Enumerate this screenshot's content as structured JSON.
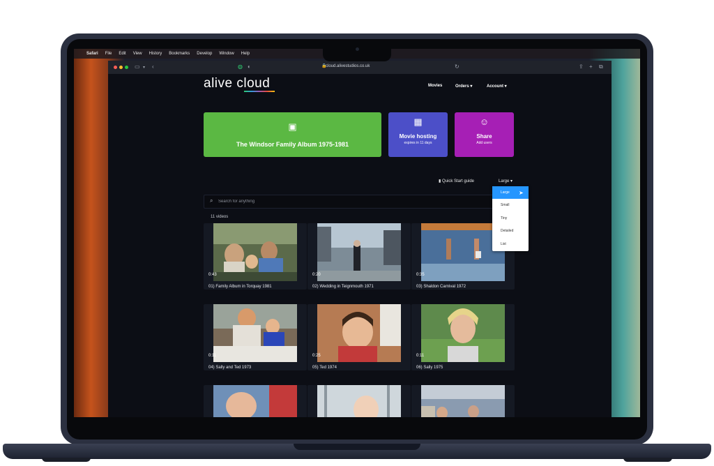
{
  "menubar": {
    "apple_icon": "",
    "items": [
      "Safari",
      "File",
      "Edit",
      "View",
      "History",
      "Bookmarks",
      "Develop",
      "Window",
      "Help"
    ]
  },
  "browser": {
    "url": "cloud.alivestudios.co.uk"
  },
  "site": {
    "logo": "alive cloud",
    "nav": [
      "Movies",
      "Orders ▾",
      "Account ▾"
    ]
  },
  "tiles": {
    "album": {
      "title": "The Windsor Family Album 1975-1981",
      "color": "#5bb843"
    },
    "hosting": {
      "title": "Movie hosting",
      "subtitle": "expires in 11 days",
      "color": "#4c4fc8"
    },
    "share": {
      "title": "Share",
      "subtitle": "Add users",
      "color": "#a61fb5"
    }
  },
  "controls": {
    "quick_start": "Quick Start guide",
    "size_label": "Large ▾",
    "size_options": [
      "Large",
      "Small",
      "Tiny",
      "Detailed",
      "List"
    ],
    "selected": "Large"
  },
  "search": {
    "placeholder": "Search for anything"
  },
  "video_count": "11 videos",
  "videos": [
    {
      "title": "01) Family Album in Torquay 1981",
      "duration": "0:43"
    },
    {
      "title": "02) Wedding in Teignmouth 1971",
      "duration": "0:20"
    },
    {
      "title": "03) Shaldon Carnival 1972",
      "duration": "0:35"
    },
    {
      "title": "04) Sally and Ted 1973",
      "duration": "0:11"
    },
    {
      "title": "05) Ted 1974",
      "duration": "0:25"
    },
    {
      "title": "06) Sally 1975",
      "duration": "0:11"
    }
  ]
}
